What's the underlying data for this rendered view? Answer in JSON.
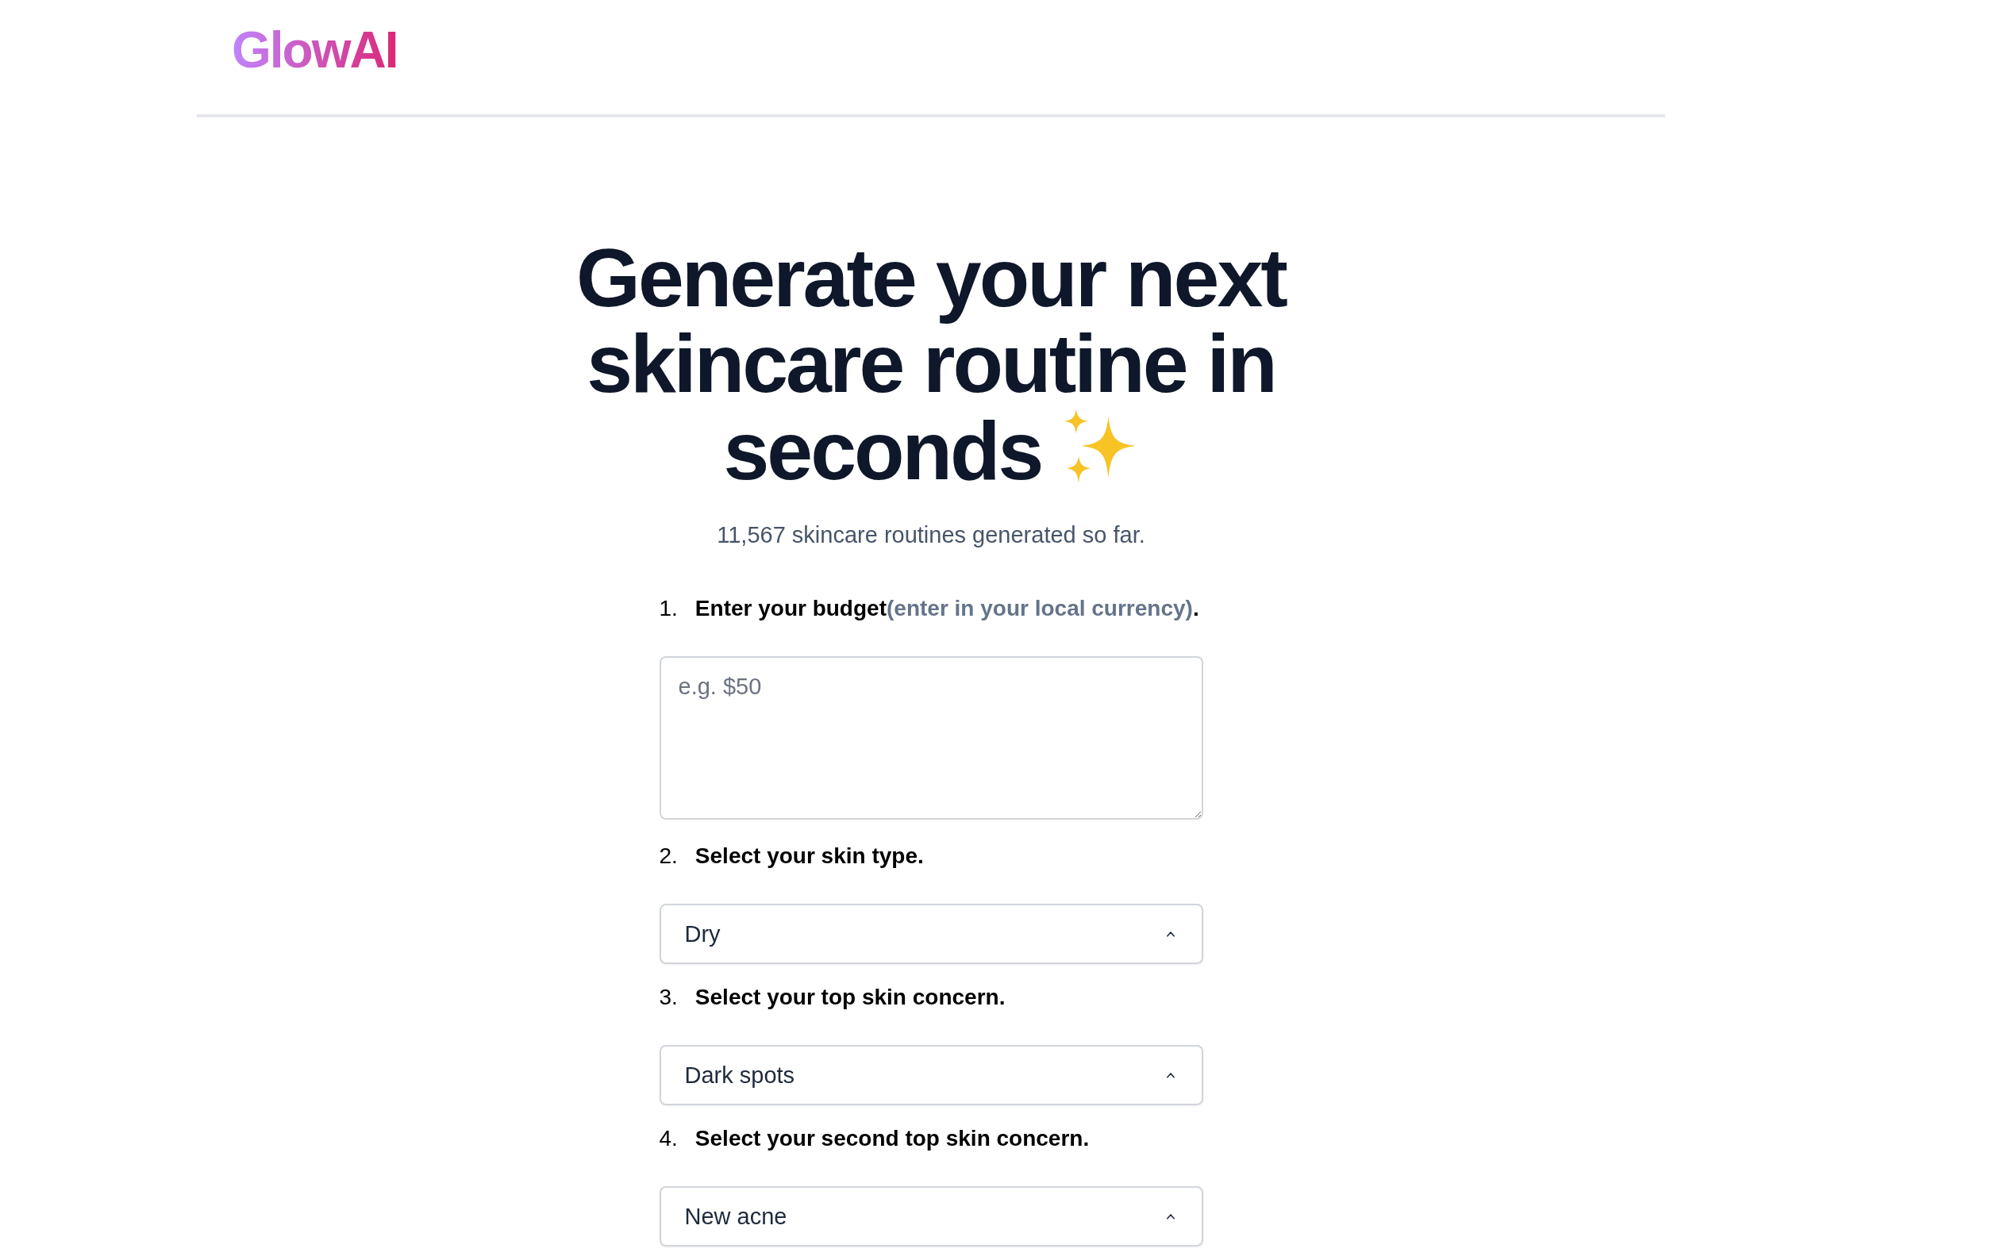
{
  "header": {
    "logo": "GlowAI"
  },
  "hero": {
    "title": "Generate your next skincare routine in seconds",
    "subtitle": "11,567 skincare routines generated so far."
  },
  "steps": [
    {
      "number": "1.",
      "label": "Enter your budget",
      "note": "(enter in your local currency)",
      "suffix": ".",
      "field": {
        "kind": "textarea",
        "placeholder": "e.g. $50"
      }
    },
    {
      "number": "2.",
      "label": "Select your skin type.",
      "field": {
        "kind": "select",
        "value": "Dry"
      }
    },
    {
      "number": "3.",
      "label": "Select your top skin concern.",
      "field": {
        "kind": "select",
        "value": "Dark spots"
      }
    },
    {
      "number": "4.",
      "label": "Select your second top skin concern.",
      "field": {
        "kind": "select",
        "value": "New acne"
      }
    }
  ]
}
